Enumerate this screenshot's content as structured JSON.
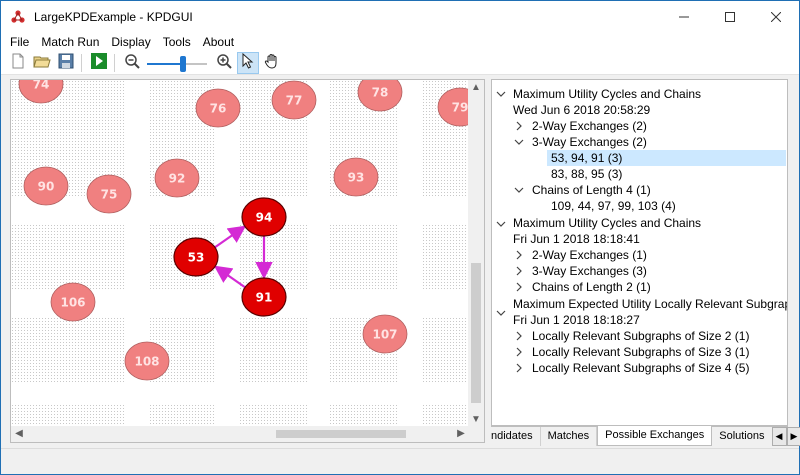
{
  "window": {
    "title": "LargeKPDExample - KPDGUI",
    "accent": "#1f6fb4"
  },
  "menu": {
    "items": [
      {
        "label": "File"
      },
      {
        "label": "Match Run"
      },
      {
        "label": "Display"
      },
      {
        "label": "Tools"
      },
      {
        "label": "About"
      }
    ]
  },
  "toolbar": {
    "icons": [
      "new-file-icon",
      "open-folder-icon",
      "save-icon",
      "run-icon",
      "zoom-out-icon",
      "zoom-slider",
      "zoom-in-icon",
      "pointer-icon",
      "hand-icon"
    ],
    "zoom_level": 0.6,
    "active_tool": "pointer"
  },
  "graph": {
    "node_color": "#f08080",
    "selected_node_color": "#e00000",
    "edge_color": "#d42ad4",
    "nodes": [
      {
        "id": "74"
      },
      {
        "id": "76"
      },
      {
        "id": "77"
      },
      {
        "id": "78"
      },
      {
        "id": "79"
      },
      {
        "id": "90"
      },
      {
        "id": "75"
      },
      {
        "id": "92"
      },
      {
        "id": "93"
      },
      {
        "id": "94",
        "selected": true
      },
      {
        "id": "53",
        "selected": true
      },
      {
        "id": "91",
        "selected": true
      },
      {
        "id": "106"
      },
      {
        "id": "107"
      },
      {
        "id": "108"
      }
    ],
    "edges": [
      {
        "from": "53",
        "to": "94"
      },
      {
        "from": "94",
        "to": "91"
      },
      {
        "from": "91",
        "to": "53"
      }
    ]
  },
  "tree": {
    "groups": [
      {
        "title": "Maximum Utility Cycles and Chains",
        "date": "Wed Jun 6 2018 20:58:29",
        "expanded": true,
        "children": [
          {
            "label": "2-Way Exchanges (2)",
            "expanded": false
          },
          {
            "label": "3-Way Exchanges (2)",
            "expanded": true,
            "children": [
              "53, 94, 91 (3)",
              "83, 88, 95 (3)"
            ]
          },
          {
            "label": "Chains of Length 4 (1)",
            "expanded": true,
            "children": [
              "109, 44, 97, 99, 103 (4)"
            ]
          }
        ]
      },
      {
        "title": "Maximum Utility Cycles and Chains",
        "date": "Fri Jun 1 2018 18:18:41",
        "expanded": true,
        "children": [
          {
            "label": "2-Way Exchanges (1)",
            "expanded": false
          },
          {
            "label": "3-Way Exchanges (3)",
            "expanded": false
          },
          {
            "label": "Chains of Length 2 (1)",
            "expanded": false
          }
        ]
      },
      {
        "title": "Maximum Expected Utility Locally Relevant Subgraphs",
        "date": "Fri Jun 1 2018 18:18:27",
        "expanded": true,
        "children": [
          {
            "label": "Locally Relevant Subgraphs of Size 2 (1)",
            "expanded": false
          },
          {
            "label": "Locally Relevant Subgraphs of Size 3 (1)",
            "expanded": false
          },
          {
            "label": "Locally Relevant Subgraphs of Size 4 (5)",
            "expanded": false
          }
        ]
      }
    ],
    "selected": "53, 94, 91 (3)"
  },
  "tabs": {
    "items": [
      {
        "label": "ndidates"
      },
      {
        "label": "Matches"
      },
      {
        "label": "Possible Exchanges",
        "active": true
      },
      {
        "label": "Solutions"
      }
    ]
  }
}
